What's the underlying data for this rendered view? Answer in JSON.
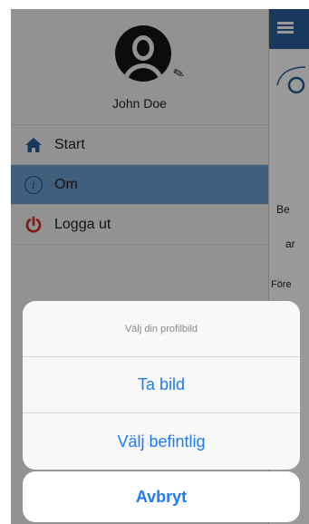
{
  "user": {
    "name": "John Doe"
  },
  "menu": {
    "items": [
      {
        "label": "Start",
        "icon": "home-icon",
        "active": false
      },
      {
        "label": "Om",
        "icon": "info-icon",
        "active": true
      },
      {
        "label": "Logga ut",
        "icon": "power-icon",
        "active": false
      }
    ]
  },
  "main_fragments": [
    "Be",
    "ar",
    "Före"
  ],
  "action_sheet": {
    "title": "Välj din profilbild",
    "buttons": [
      "Ta bild",
      "Välj befintlig"
    ],
    "cancel_label": "Avbryt"
  },
  "colors": {
    "accent": "#1e7bf6",
    "header": "#2b5f99",
    "active_row": "#6a9fd0",
    "logout_red": "#d0312d",
    "home_blue": "#2b5f99"
  }
}
